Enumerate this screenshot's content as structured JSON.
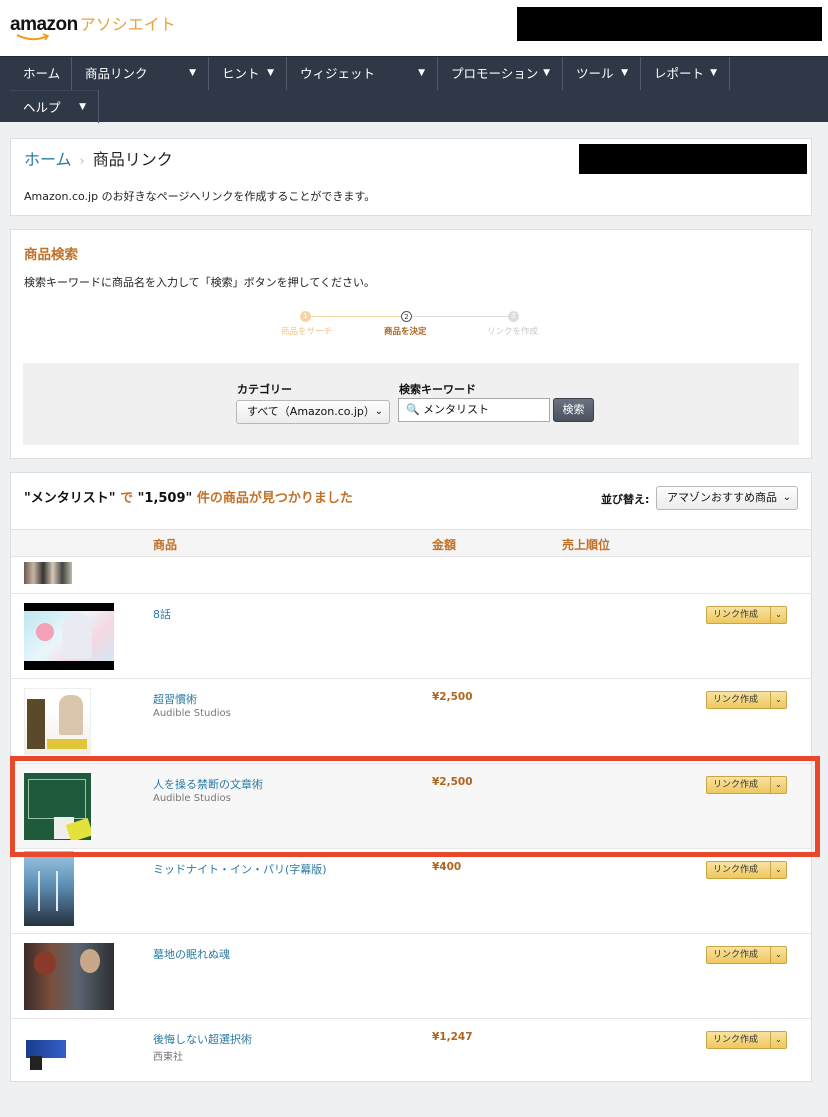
{
  "header": {
    "logo_word": "amazon",
    "logo_suffix": "アソシエイト"
  },
  "nav": {
    "items": [
      "ホーム",
      "商品リンク",
      "ヒント",
      "ウィジェット",
      "プロモーション",
      "ツール",
      "レポート",
      "ヘルプ"
    ],
    "caret": "▼"
  },
  "breadcrumb": {
    "home": "ホーム",
    "separator": "›",
    "current": "商品リンク"
  },
  "intro": {
    "description": "Amazon.co.jp のお好きなページへリンクを作成することができます。"
  },
  "search_panel": {
    "title": "商品検索",
    "instructions": "検索キーワードに商品名を入力して「検索」ボタンを押してください。",
    "steps": [
      {
        "num": "1",
        "label": "商品をサーチ"
      },
      {
        "num": "2",
        "label": "商品を決定"
      },
      {
        "num": "3",
        "label": "リンクを作成"
      }
    ],
    "category_label": "カテゴリー",
    "category_value": "すべて（Amazon.co.jp）",
    "keyword_label": "検索キーワード",
    "keyword_value": "メンタリスト",
    "search_button": "検索"
  },
  "results": {
    "query": "\"メンタリスト\"",
    "de": "で",
    "count": "\"1,509\"",
    "suffix": "件の商品が見つかりました",
    "sort_label": "並び替え:",
    "sort_value": "アマゾンおすすめ商品",
    "columns": {
      "product": "商品",
      "price": "金額",
      "rank": "売上順位"
    },
    "link_button": "リンク作成",
    "items": [
      {
        "title": "8話",
        "maker": "",
        "price": ""
      },
      {
        "title": "超習慣術",
        "maker": "Audible Studios",
        "price": "¥2,500"
      },
      {
        "title": "人を操る禁断の文章術",
        "maker": "Audible Studios",
        "price": "¥2,500"
      },
      {
        "title": "ミッドナイト・イン・パリ(字幕版)",
        "maker": "",
        "price": "¥400"
      },
      {
        "title": "墓地の眠れぬ魂",
        "maker": "",
        "price": ""
      },
      {
        "title": "後悔しない超選択術",
        "maker": "西東社",
        "price": "¥1,247"
      }
    ]
  },
  "colors": {
    "accent": "#c0722a",
    "link": "#2b7aa3",
    "nav_bg": "#2e3847",
    "highlight": "#e8472a"
  }
}
